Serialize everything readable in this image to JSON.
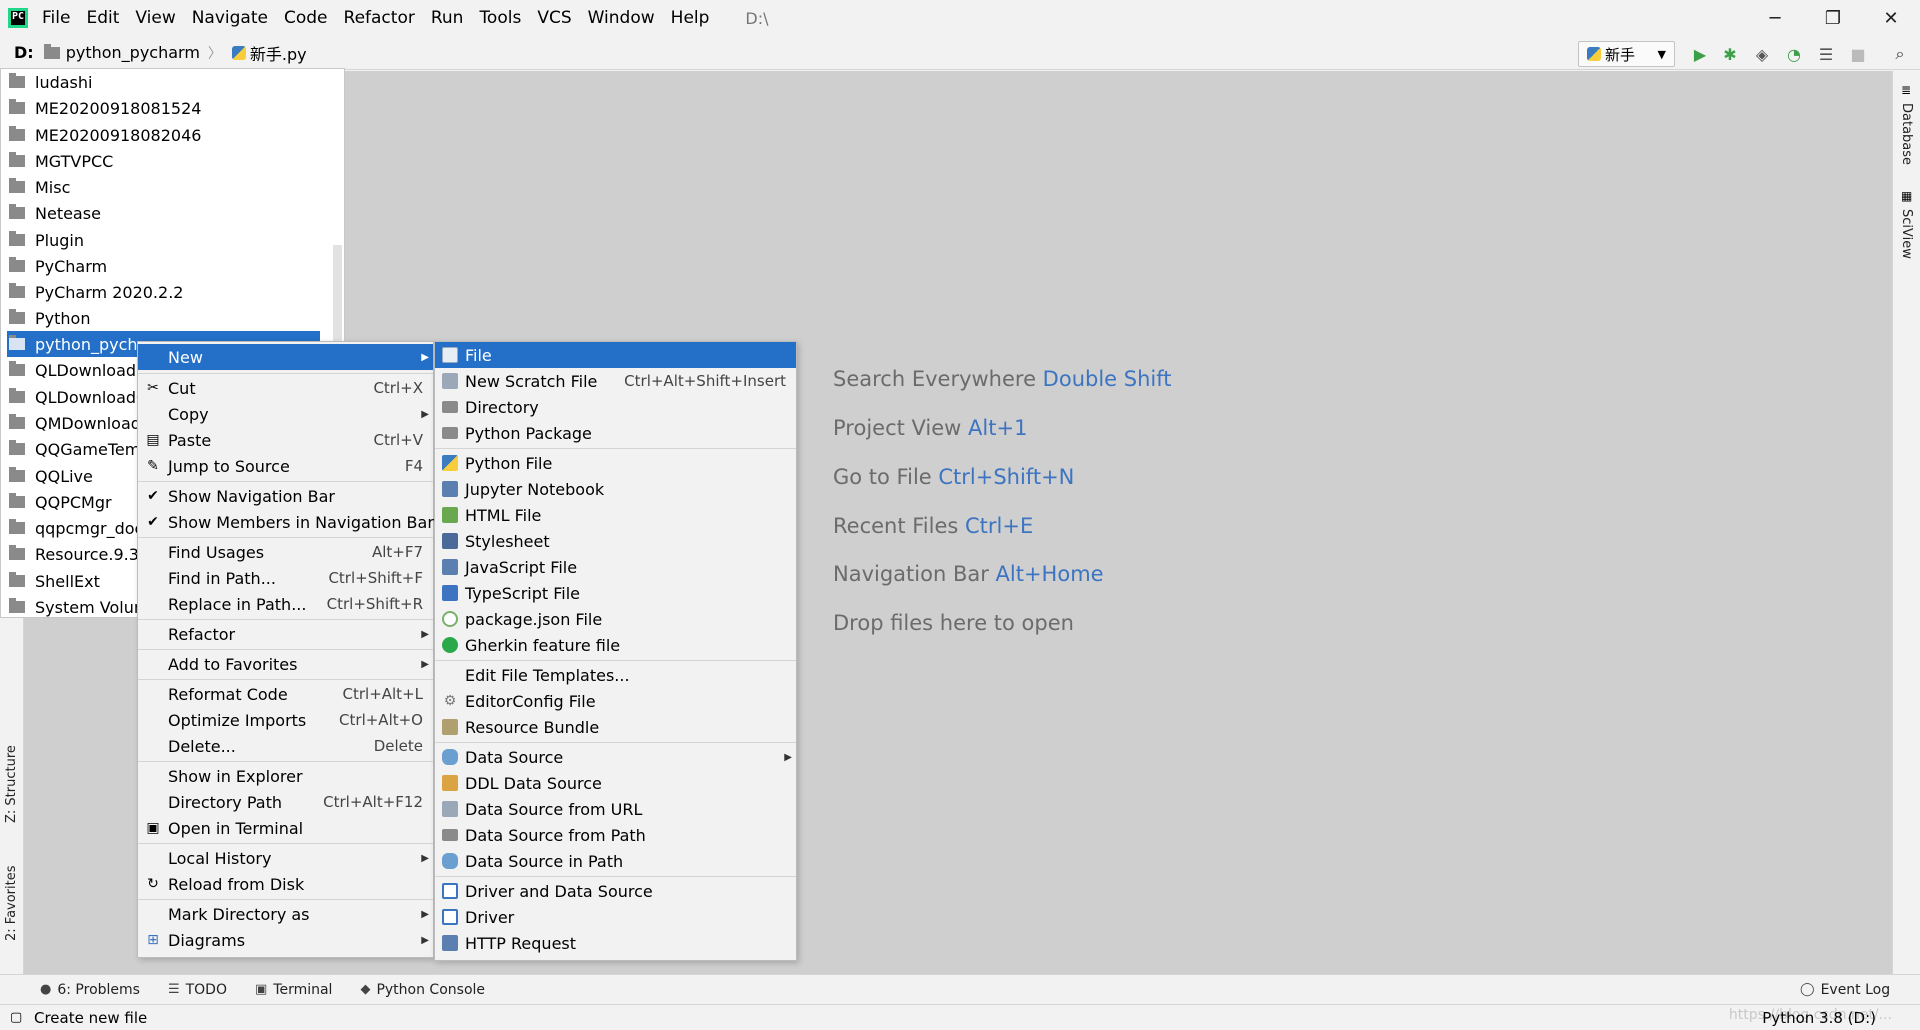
{
  "window": {
    "menu": [
      "File",
      "Edit",
      "View",
      "Navigate",
      "Code",
      "Refactor",
      "Run",
      "Tools",
      "VCS",
      "Window",
      "Help"
    ],
    "path": "D:\\",
    "controls": {
      "minimize": "─",
      "restore": "❐",
      "close": "✕"
    }
  },
  "navbar": {
    "crumbs": [
      "D:",
      "python_pycharm",
      "新手.py"
    ],
    "run_config": "新手"
  },
  "tree": {
    "items": [
      "ludashi",
      "ME20200918081524",
      "ME20200918082046",
      "MGTVPCC",
      "Misc",
      "Netease",
      "Plugin",
      "PyCharm",
      "PyCharm 2020.2.2",
      "Python",
      "python_pycharm",
      "QLDownload",
      "QLDownloadG",
      "QMDownload",
      "QQGameTemp",
      "QQLive",
      "QQPCMgr",
      "qqpcmgr_doc",
      "Resource.9.3.8",
      "ShellExt",
      "System Volum"
    ]
  },
  "context_menu": {
    "items": [
      {
        "label": "New",
        "shortcut": "",
        "arrow": true
      },
      {
        "label": "Cut",
        "shortcut": "Ctrl+X"
      },
      {
        "label": "Copy",
        "shortcut": "",
        "arrow": true
      },
      {
        "label": "Paste",
        "shortcut": "Ctrl+V"
      },
      {
        "label": "Jump to Source",
        "shortcut": "F4"
      },
      {
        "label": "Show Navigation Bar",
        "shortcut": ""
      },
      {
        "label": "Show Members in Navigation Bar",
        "shortcut": ""
      },
      {
        "label": "Find Usages",
        "shortcut": "Alt+F7"
      },
      {
        "label": "Find in Path...",
        "shortcut": "Ctrl+Shift+F"
      },
      {
        "label": "Replace in Path...",
        "shortcut": "Ctrl+Shift+R"
      },
      {
        "label": "Refactor",
        "shortcut": "",
        "arrow": true
      },
      {
        "label": "Add to Favorites",
        "shortcut": "",
        "arrow": true
      },
      {
        "label": "Reformat Code",
        "shortcut": "Ctrl+Alt+L"
      },
      {
        "label": "Optimize Imports",
        "shortcut": "Ctrl+Alt+O"
      },
      {
        "label": "Delete...",
        "shortcut": "Delete"
      },
      {
        "label": "Show in Explorer",
        "shortcut": ""
      },
      {
        "label": "Directory Path",
        "shortcut": "Ctrl+Alt+F12"
      },
      {
        "label": "Open in Terminal",
        "shortcut": ""
      },
      {
        "label": "Local History",
        "shortcut": "",
        "arrow": true
      },
      {
        "label": "Reload from Disk",
        "shortcut": ""
      },
      {
        "label": "Mark Directory as",
        "shortcut": "",
        "arrow": true
      },
      {
        "label": "Diagrams",
        "shortcut": "",
        "arrow": true
      }
    ]
  },
  "new_submenu": {
    "items": [
      {
        "label": "File",
        "shortcut": ""
      },
      {
        "label": "New Scratch File",
        "shortcut": "Ctrl+Alt+Shift+Insert"
      },
      {
        "label": "Directory",
        "shortcut": ""
      },
      {
        "label": "Python Package",
        "shortcut": ""
      },
      {
        "label": "Python File",
        "shortcut": ""
      },
      {
        "label": "Jupyter Notebook",
        "shortcut": ""
      },
      {
        "label": "HTML File",
        "shortcut": ""
      },
      {
        "label": "Stylesheet",
        "shortcut": ""
      },
      {
        "label": "JavaScript File",
        "shortcut": ""
      },
      {
        "label": "TypeScript File",
        "shortcut": ""
      },
      {
        "label": "package.json File",
        "shortcut": ""
      },
      {
        "label": "Gherkin feature file",
        "shortcut": ""
      },
      {
        "label": "Edit File Templates...",
        "shortcut": ""
      },
      {
        "label": "EditorConfig File",
        "shortcut": ""
      },
      {
        "label": "Resource Bundle",
        "shortcut": ""
      },
      {
        "label": "Data Source",
        "shortcut": ""
      },
      {
        "label": "DDL Data Source",
        "shortcut": ""
      },
      {
        "label": "Data Source from URL",
        "shortcut": ""
      },
      {
        "label": "Data Source from Path",
        "shortcut": ""
      },
      {
        "label": "Data Source in Path",
        "shortcut": ""
      },
      {
        "label": "Driver and Data Source",
        "shortcut": ""
      },
      {
        "label": "Driver",
        "shortcut": ""
      },
      {
        "label": "HTTP Request",
        "shortcut": ""
      }
    ]
  },
  "editor_hints": [
    {
      "text": "Search Everywhere ",
      "key": "Double Shift"
    },
    {
      "text": "Project View ",
      "key": "Alt+1"
    },
    {
      "text": "Go to File ",
      "key": "Ctrl+Shift+N"
    },
    {
      "text": "Recent Files ",
      "key": "Ctrl+E"
    },
    {
      "text": "Navigation Bar ",
      "key": "Alt+Home"
    },
    {
      "text": "Drop files here to open",
      "key": ""
    }
  ],
  "side_tabs": {
    "right": [
      "Database",
      "SciView"
    ],
    "left": [
      "Z: Structure",
      "2: Favorites"
    ]
  },
  "bottom_tabs": [
    "6: Problems",
    "TODO",
    "Terminal",
    "Python Console"
  ],
  "event_log": "Event Log",
  "status": {
    "text": "Create new file",
    "interpreter": "Python 3.8 (D:)",
    "watermark": "https://blog.csdn.net/..."
  },
  "colors": {
    "selection": "#2470c8",
    "hint_key": "#3c74c2",
    "editor_bg": "#cfcfcf"
  }
}
